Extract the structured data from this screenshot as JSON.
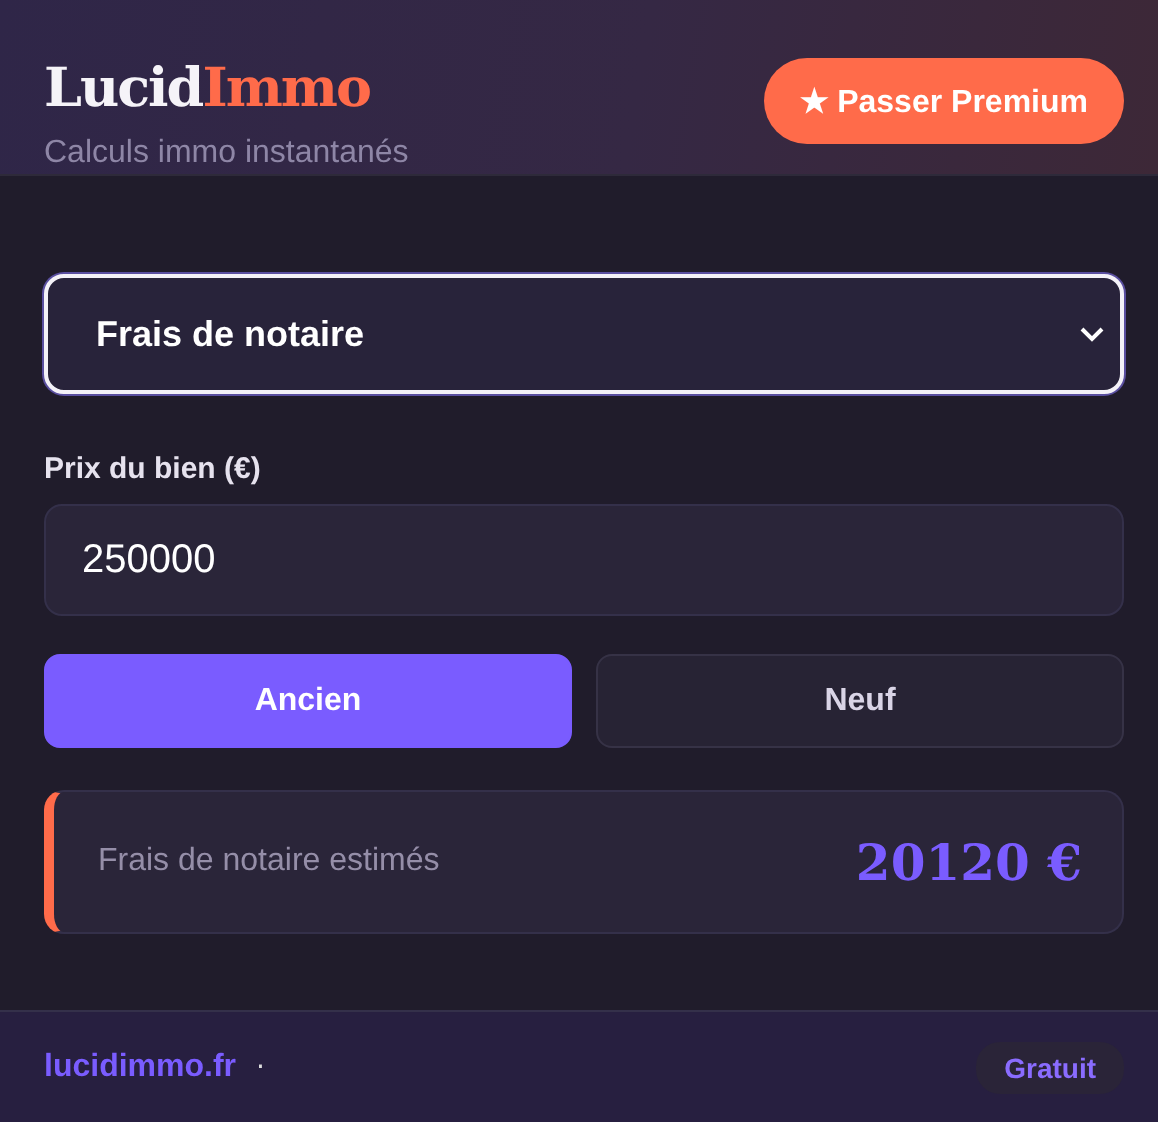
{
  "header": {
    "logo": {
      "part_1": "Lucid",
      "part_2": "Immo"
    },
    "tagline": "Calculs immo instantanés",
    "premium_button": {
      "icon": "★",
      "label": "Passer Premium"
    }
  },
  "calculator_select": {
    "value": "Frais de notaire"
  },
  "price_field": {
    "label": "Prix du bien (€)",
    "value": "250000"
  },
  "property_type": [
    {
      "label": "Ancien",
      "selected": true
    },
    {
      "label": "Neuf",
      "selected": false
    }
  ],
  "result": {
    "label": "Frais de notaire estimés",
    "value": "20120 €"
  },
  "footer": {
    "link": "lucidimmo.fr",
    "separator": "·",
    "badge": "Gratuit"
  }
}
